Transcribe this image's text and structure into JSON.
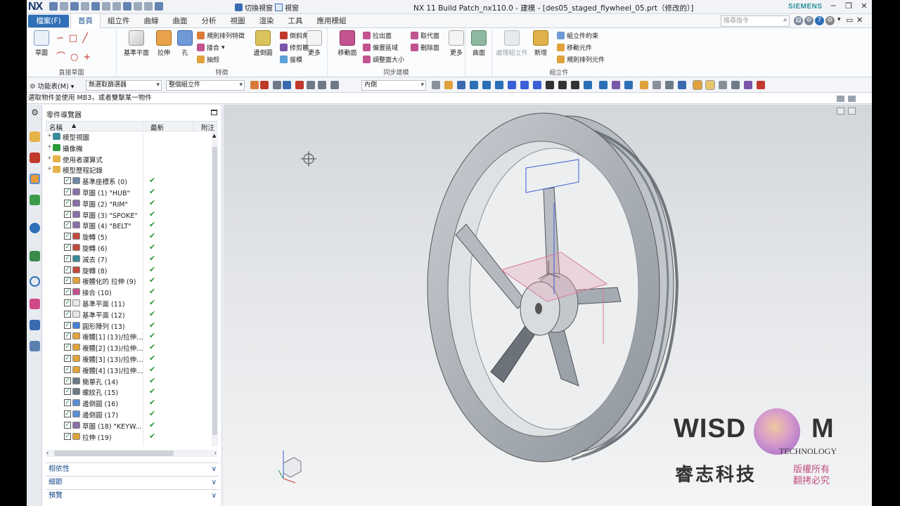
{
  "titlebar": {
    "app_logo": "NX",
    "switch_window": "切換視窗",
    "window_menu": "視窗",
    "title": "NX 11  Build Patch_nx110.0 - 建模 - [des05_staged_flywheel_05.prt（修改的）]",
    "brand": "SIEMENS"
  },
  "menubar": {
    "file_label": "檔案(F)",
    "tabs": [
      "首頁",
      "組立件",
      "曲線",
      "曲面",
      "分析",
      "視圖",
      "渲染",
      "工具",
      "應用模組"
    ],
    "search_placeholder": "搜尋指令"
  },
  "ribbon": {
    "direct_sketch": {
      "label": "直接草圖",
      "sketch_btn": "草圖"
    },
    "feature": {
      "label": "特徵",
      "datum_plane": "基準平面",
      "extrude": "拉伸",
      "hole": "孔",
      "pattern_feature": "規則排列特徵",
      "unite": "接合",
      "shell": "抽殼",
      "edge_blend": "邊倒圓",
      "chamfer": "倒斜角",
      "trim_body": "修剪體",
      "draft": "拔模",
      "more": "更多"
    },
    "sync_modeling": {
      "label": "同步建模",
      "move_face": "移動面",
      "pull_face": "拉出面",
      "offset_region": "偏置區域",
      "resize_blend": "調整面大小",
      "replace_face": "取代面",
      "delete_face": "刪除面",
      "more": "更多"
    },
    "surface": {
      "surface_btn": "曲面"
    },
    "assembly": {
      "label": "組立件",
      "wave_linker": "處理組立件",
      "new": "新增",
      "constraints": "組立件約束",
      "move_component": "移動元件",
      "pattern_component": "規則排列元件"
    }
  },
  "toolbar2": {
    "menu_label": "功能表(M)",
    "selection_filter": "無選取篩選器",
    "scope": "整個組立件",
    "snap": "內側"
  },
  "status": {
    "prompt": "選取物件並使用 MB3，或者雙擊某一物件"
  },
  "navigator": {
    "title": "零件導覽器",
    "columns": {
      "name": "名稱",
      "latest": "最新",
      "comment": "附注"
    },
    "nodes": [
      {
        "label": "模型視圖",
        "level": 0,
        "check": false,
        "latest": false
      },
      {
        "label": "攝像機",
        "level": 0,
        "check": false,
        "latest": false
      },
      {
        "label": "使用者運算式",
        "level": 0,
        "check": false,
        "latest": false
      },
      {
        "label": "模型歷程記錄",
        "level": 0,
        "check": false,
        "latest": false
      },
      {
        "label": "基準座標系 (0)",
        "level": 1,
        "check": true,
        "latest": true
      },
      {
        "label": "草圖 (1) \"HUB\"",
        "level": 1,
        "check": true,
        "latest": true
      },
      {
        "label": "草圖 (2) \"RIM\"",
        "level": 1,
        "check": true,
        "latest": true
      },
      {
        "label": "草圖 (3) \"SPOKE\"",
        "level": 1,
        "check": true,
        "latest": true
      },
      {
        "label": "草圖 (4) \"BELT\"",
        "level": 1,
        "check": true,
        "latest": true
      },
      {
        "label": "旋轉 (5)",
        "level": 1,
        "check": true,
        "latest": true
      },
      {
        "label": "旋轉 (6)",
        "level": 1,
        "check": true,
        "latest": true
      },
      {
        "label": "減去 (7)",
        "level": 1,
        "check": true,
        "latest": true
      },
      {
        "label": "旋轉 (8)",
        "level": 1,
        "check": true,
        "latest": true
      },
      {
        "label": "複體化的 拉伸 (9)",
        "level": 1,
        "check": true,
        "latest": true
      },
      {
        "label": "接合 (10)",
        "level": 1,
        "check": true,
        "latest": true
      },
      {
        "label": "基準平面 (11)",
        "level": 1,
        "check": true,
        "latest": true
      },
      {
        "label": "基準平面 (12)",
        "level": 1,
        "check": true,
        "latest": true
      },
      {
        "label": "圓形陣列 (13)",
        "level": 1,
        "check": true,
        "latest": true
      },
      {
        "label": "複體[1] (13)/拉伸 (...",
        "level": 1,
        "check": true,
        "latest": true
      },
      {
        "label": "複體[2] (13)/拉伸 (...",
        "level": 1,
        "check": true,
        "latest": true
      },
      {
        "label": "複體[3] (13)/拉伸 (...",
        "level": 1,
        "check": true,
        "latest": true
      },
      {
        "label": "複體[4] (13)/拉伸 (...",
        "level": 1,
        "check": true,
        "latest": true
      },
      {
        "label": "簡單孔 (14)",
        "level": 1,
        "check": true,
        "latest": true
      },
      {
        "label": "螺紋孔 (15)",
        "level": 1,
        "check": true,
        "latest": true
      },
      {
        "label": "邊倒圓 (16)",
        "level": 1,
        "check": true,
        "latest": true
      },
      {
        "label": "邊倒圓 (17)",
        "level": 1,
        "check": true,
        "latest": true
      },
      {
        "label": "草圖 (18) \"KEYW...",
        "level": 1,
        "check": true,
        "latest": true
      },
      {
        "label": "拉伸 (19)",
        "level": 1,
        "check": true,
        "latest": true
      }
    ],
    "sections": [
      "相依性",
      "細節",
      "預覽"
    ]
  },
  "watermark": {
    "brand_left": "WISD",
    "brand_right": "M",
    "sub": "TECHNOLOGY",
    "chinese": "睿志科技",
    "rights_1": "版權所有",
    "rights_2": "翻拷必究"
  },
  "colors": {
    "file_tab": "#2e6fb7",
    "accent_blue": "#1b4e8f",
    "check_green": "#2b9a3d",
    "siemens": "#2a8f9a",
    "model_gray": "#b7bcc1",
    "datum_pink": "#e8a7b8"
  }
}
